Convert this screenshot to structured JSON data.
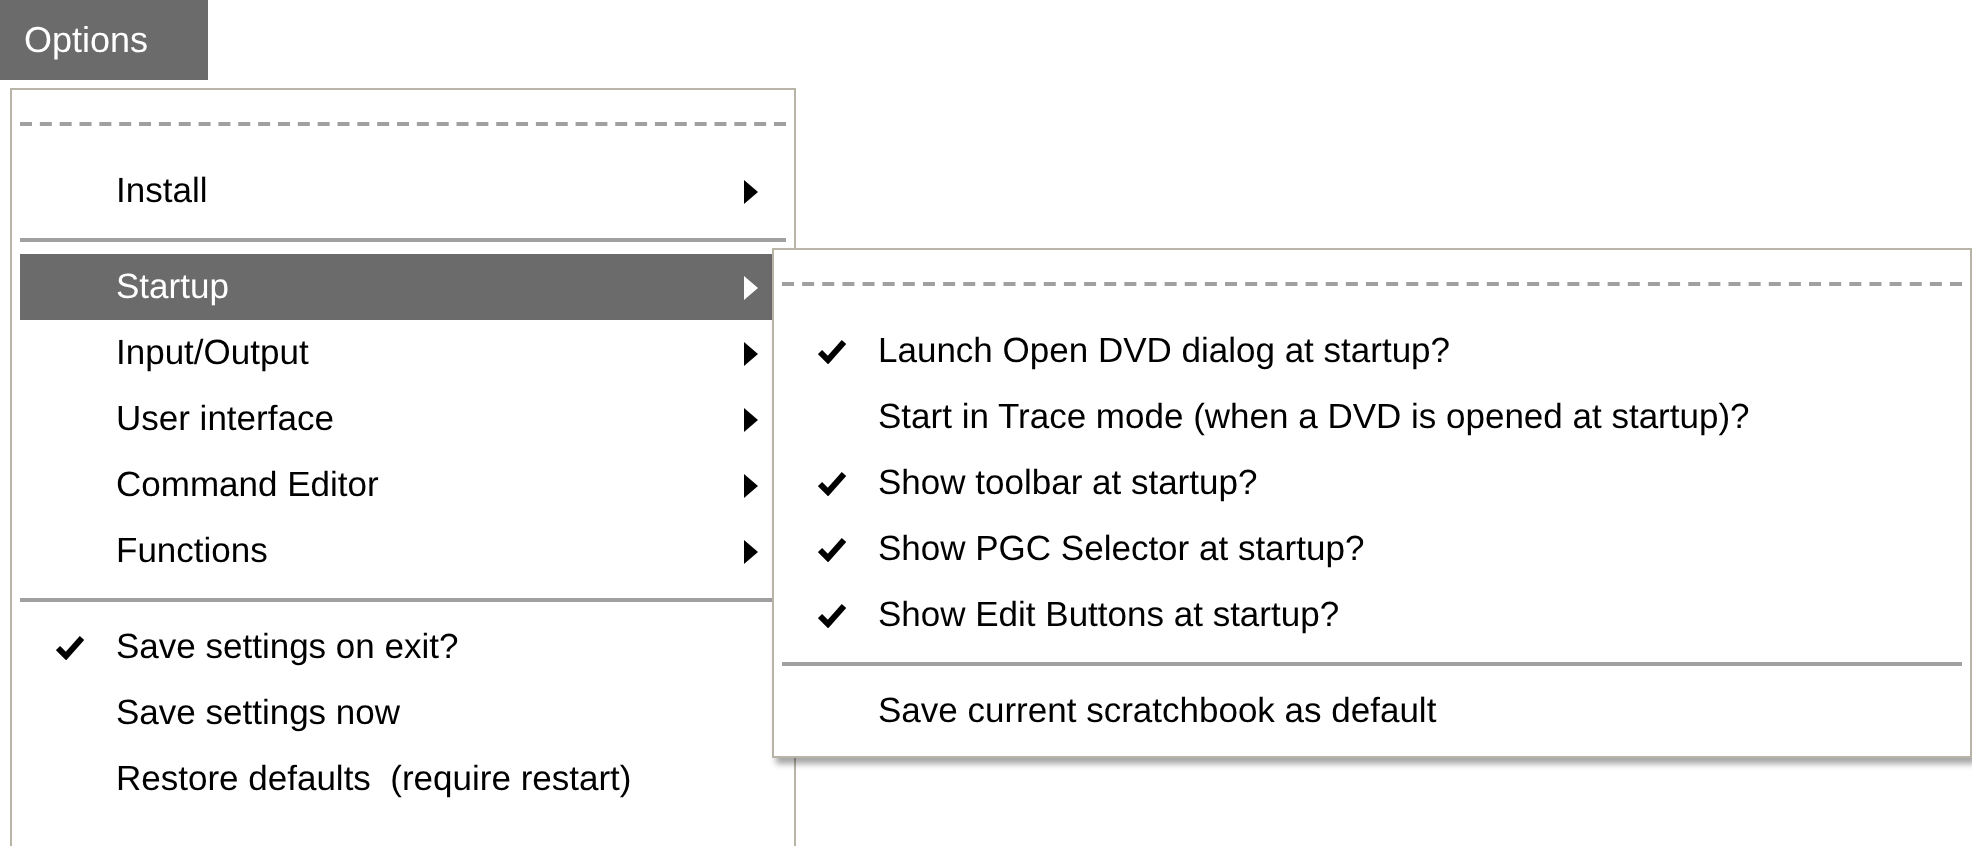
{
  "menu_bar": {
    "title": "Options",
    "selected": true
  },
  "menu": {
    "items": [
      {
        "kind": "tearoff"
      },
      {
        "kind": "item",
        "label": "Install",
        "checked": false,
        "selected": false,
        "submenu": true
      },
      {
        "kind": "separator"
      },
      {
        "kind": "item",
        "label": "Startup",
        "checked": false,
        "selected": true,
        "submenu": true
      },
      {
        "kind": "item",
        "label": "Input/Output",
        "checked": false,
        "selected": false,
        "submenu": true
      },
      {
        "kind": "item",
        "label": "User interface",
        "checked": false,
        "selected": false,
        "submenu": true
      },
      {
        "kind": "item",
        "label": "Command Editor",
        "checked": false,
        "selected": false,
        "submenu": true
      },
      {
        "kind": "item",
        "label": "Functions",
        "checked": false,
        "selected": false,
        "submenu": true
      },
      {
        "kind": "separator"
      },
      {
        "kind": "item",
        "label": "Save settings on exit?",
        "checked": true,
        "selected": false,
        "submenu": false
      },
      {
        "kind": "item",
        "label": "Save settings now",
        "checked": false,
        "selected": false,
        "submenu": false
      },
      {
        "kind": "item",
        "label": "Restore defaults  (require restart)",
        "checked": false,
        "selected": false,
        "submenu": false
      }
    ]
  },
  "submenu": {
    "items": [
      {
        "kind": "tearoff"
      },
      {
        "kind": "item",
        "label": "Launch Open DVD dialog at startup?",
        "checked": true,
        "selected": false,
        "submenu": false
      },
      {
        "kind": "item",
        "label": "Start in Trace mode (when a DVD is opened at startup)?",
        "checked": false,
        "selected": false,
        "submenu": false
      },
      {
        "kind": "item",
        "label": "Show toolbar at startup?",
        "checked": true,
        "selected": false,
        "submenu": false
      },
      {
        "kind": "item",
        "label": "Show PGC Selector at startup?",
        "checked": true,
        "selected": false,
        "submenu": false
      },
      {
        "kind": "item",
        "label": "Show Edit Buttons at startup?",
        "checked": true,
        "selected": false,
        "submenu": false
      },
      {
        "kind": "separator"
      },
      {
        "kind": "item",
        "label": "Save current scratchbook as default",
        "checked": false,
        "selected": false,
        "submenu": false
      }
    ]
  }
}
